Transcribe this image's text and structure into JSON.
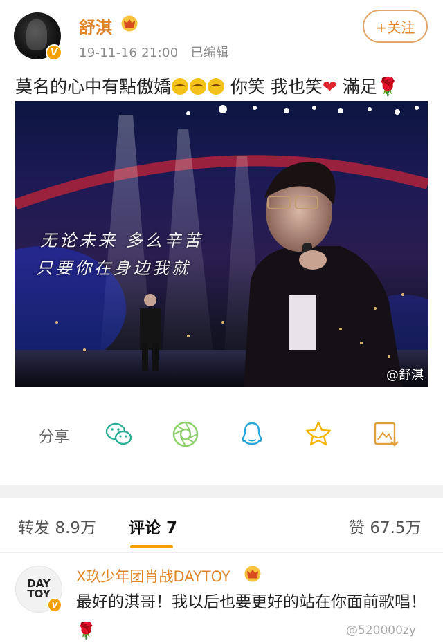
{
  "post": {
    "username": "舒淇",
    "timestamp": "19-11-16 21:00",
    "edited_label": "已编辑",
    "follow_label": "+关注",
    "text_prefix": "莫名的心中有點傲嬌",
    "text_middle": "你笑 我也笑",
    "text_suffix": "滿足",
    "rose": "🌹",
    "image": {
      "lyric_line1": "无论未来 多么辛苦",
      "lyric_line2": "只要你在身边我就",
      "watermark": "@舒淇"
    }
  },
  "share": {
    "label": "分享",
    "icons": [
      "wechat-icon",
      "moments-icon",
      "qq-icon",
      "favorite-star-icon",
      "save-image-icon"
    ],
    "accent": "#2ab096",
    "star_color": "#f5b400"
  },
  "stats": {
    "repost_label": "转发",
    "repost_count": "8.9万",
    "comment_label": "评论",
    "comment_count": "7",
    "like_label": "赞",
    "like_count": "67.5万"
  },
  "comment": {
    "avatar_text_line1": "DAY",
    "avatar_text_line2": "TOY",
    "name": "X玖少年团肖战DAYTOY",
    "text": "最好的淇哥！我以后也要更好的站在你面前歌唱！",
    "watermark": "@520000zy"
  },
  "colors": {
    "brand_orange": "#e0862a",
    "badge_gold": "#f5a100"
  }
}
